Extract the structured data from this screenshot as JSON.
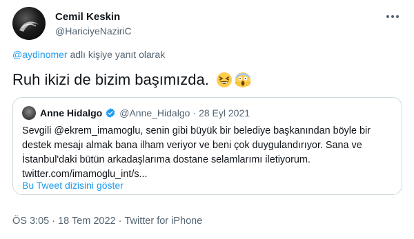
{
  "author": {
    "name": "Cemil Keskin",
    "handle": "@HariciyeNaziriC"
  },
  "reply_context": {
    "mention": "@aydinomer",
    "suffix": " adlı kişiye yanıt olarak"
  },
  "tweet": {
    "text": "Ruh ikizi de bizim başımızda.",
    "emojis": [
      "grinning-squinting-face-icon",
      "face-screaming-in-fear-icon"
    ]
  },
  "quoted_tweet": {
    "name": "Anne Hidalgo",
    "handle": "@Anne_Hidalgo",
    "dot": "·",
    "date": "28 Eyl 2021",
    "body_lines": [
      "Sevgili @ekrem_imamoglu, senin gibi büyük bir belediye başkanından böyle bir",
      "destek mesajı almak bana ilham veriyor ve beni çok duygulandırıyor. Sana ve",
      "İstanbul'daki bütün arkadaşlarıma dostane selamlarımı iletiyorum.",
      "twitter.com/imamoglu_int/s..."
    ],
    "thread_link": "Bu Tweet dizisini göster"
  },
  "meta": {
    "time": "ÖS 3:05",
    "sep": "·",
    "date": "18 Tem 2022",
    "source": "Twitter for iPhone"
  },
  "colors": {
    "link": "#1d9bf0",
    "secondary_text": "#536471",
    "border": "#cfd9de"
  }
}
